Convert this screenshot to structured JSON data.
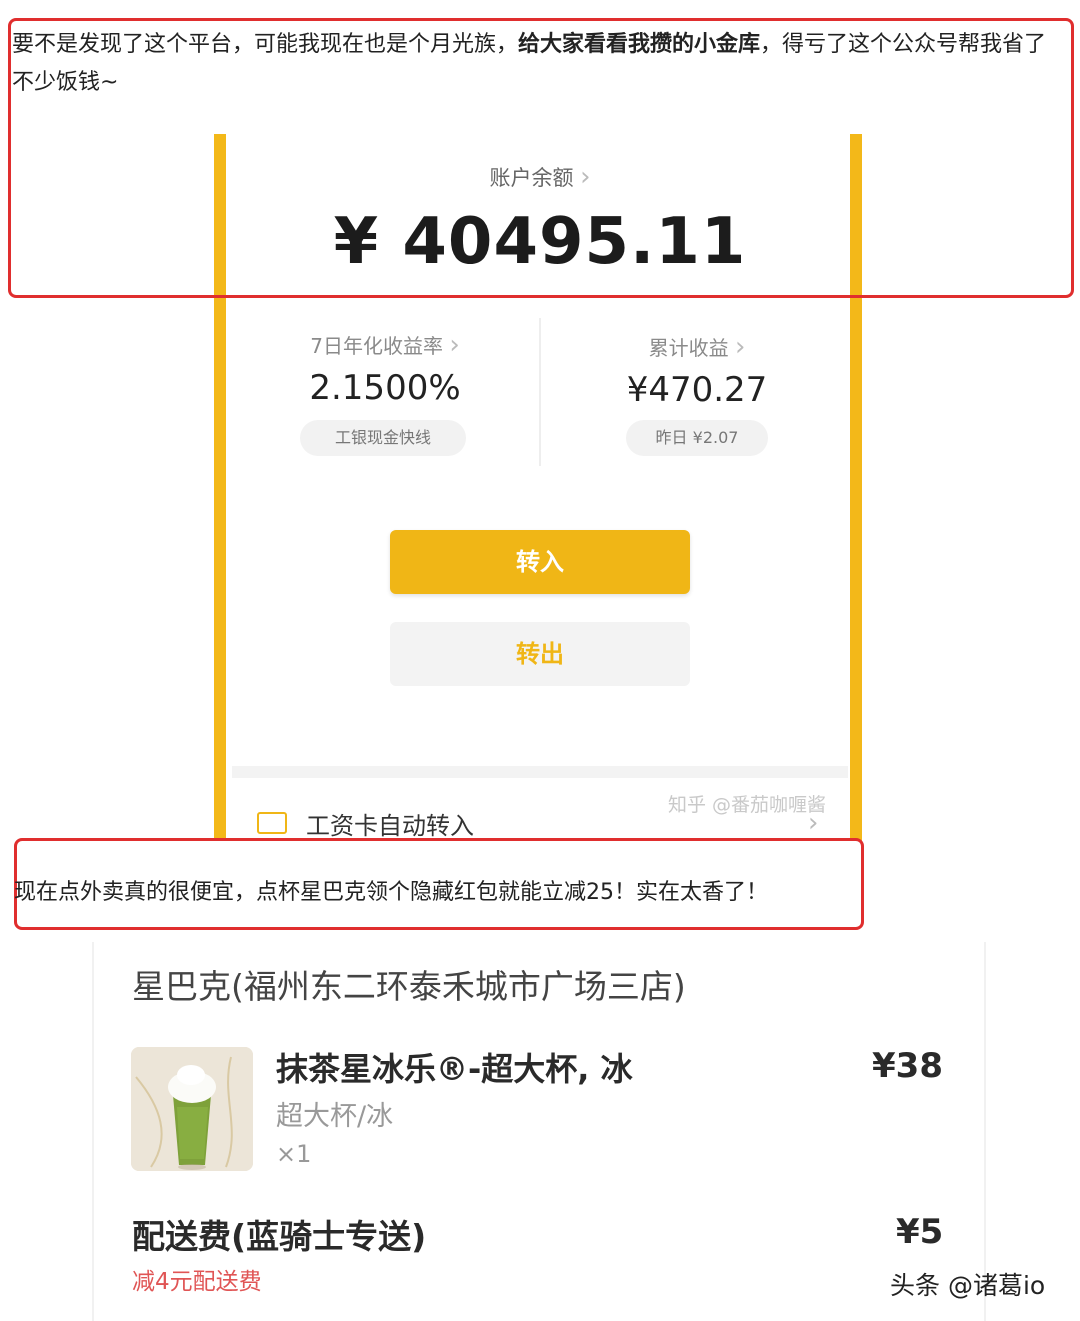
{
  "intro": {
    "part1": "要不是发现了这个平台，可能我现在也是个月光族，",
    "bold": "给大家看看我攒的小金库",
    "part2": "，得亏了这个公众号帮我省了不少饭钱~"
  },
  "wallet": {
    "balance_label": "账户余额",
    "balance_value": "¥ 40495.11",
    "yield_label": "7日年化收益率",
    "yield_value": "2.1500%",
    "yield_pill": "工银现金快线",
    "earnings_label": "累计收益",
    "earnings_value": "¥470.27",
    "earnings_pill": "昨日 ¥2.07",
    "transfer_in": "转入",
    "transfer_out": "转出",
    "salary_auto": "工资卡自动转入",
    "watermark": "知乎 @番茄咖喱酱",
    "chevron": "›",
    "accent_color": "#f0b616"
  },
  "mid_text": "现在点外卖真的很便宜，点杯星巴克领个隐藏红包就能立减25！实在太香了！",
  "order": {
    "store": "星巴克(福州东二环泰禾城市广场三店)",
    "item_name": "抹茶星冰乐®-超大杯, 冰",
    "item_spec": "超大杯/冰",
    "item_qty": "×1",
    "item_price": "¥38",
    "fee_label": "配送费(蓝骑士专送)",
    "fee_sub": "减4元配送费",
    "fee_price": "¥5"
  },
  "brand": "头条 @诸葛io"
}
